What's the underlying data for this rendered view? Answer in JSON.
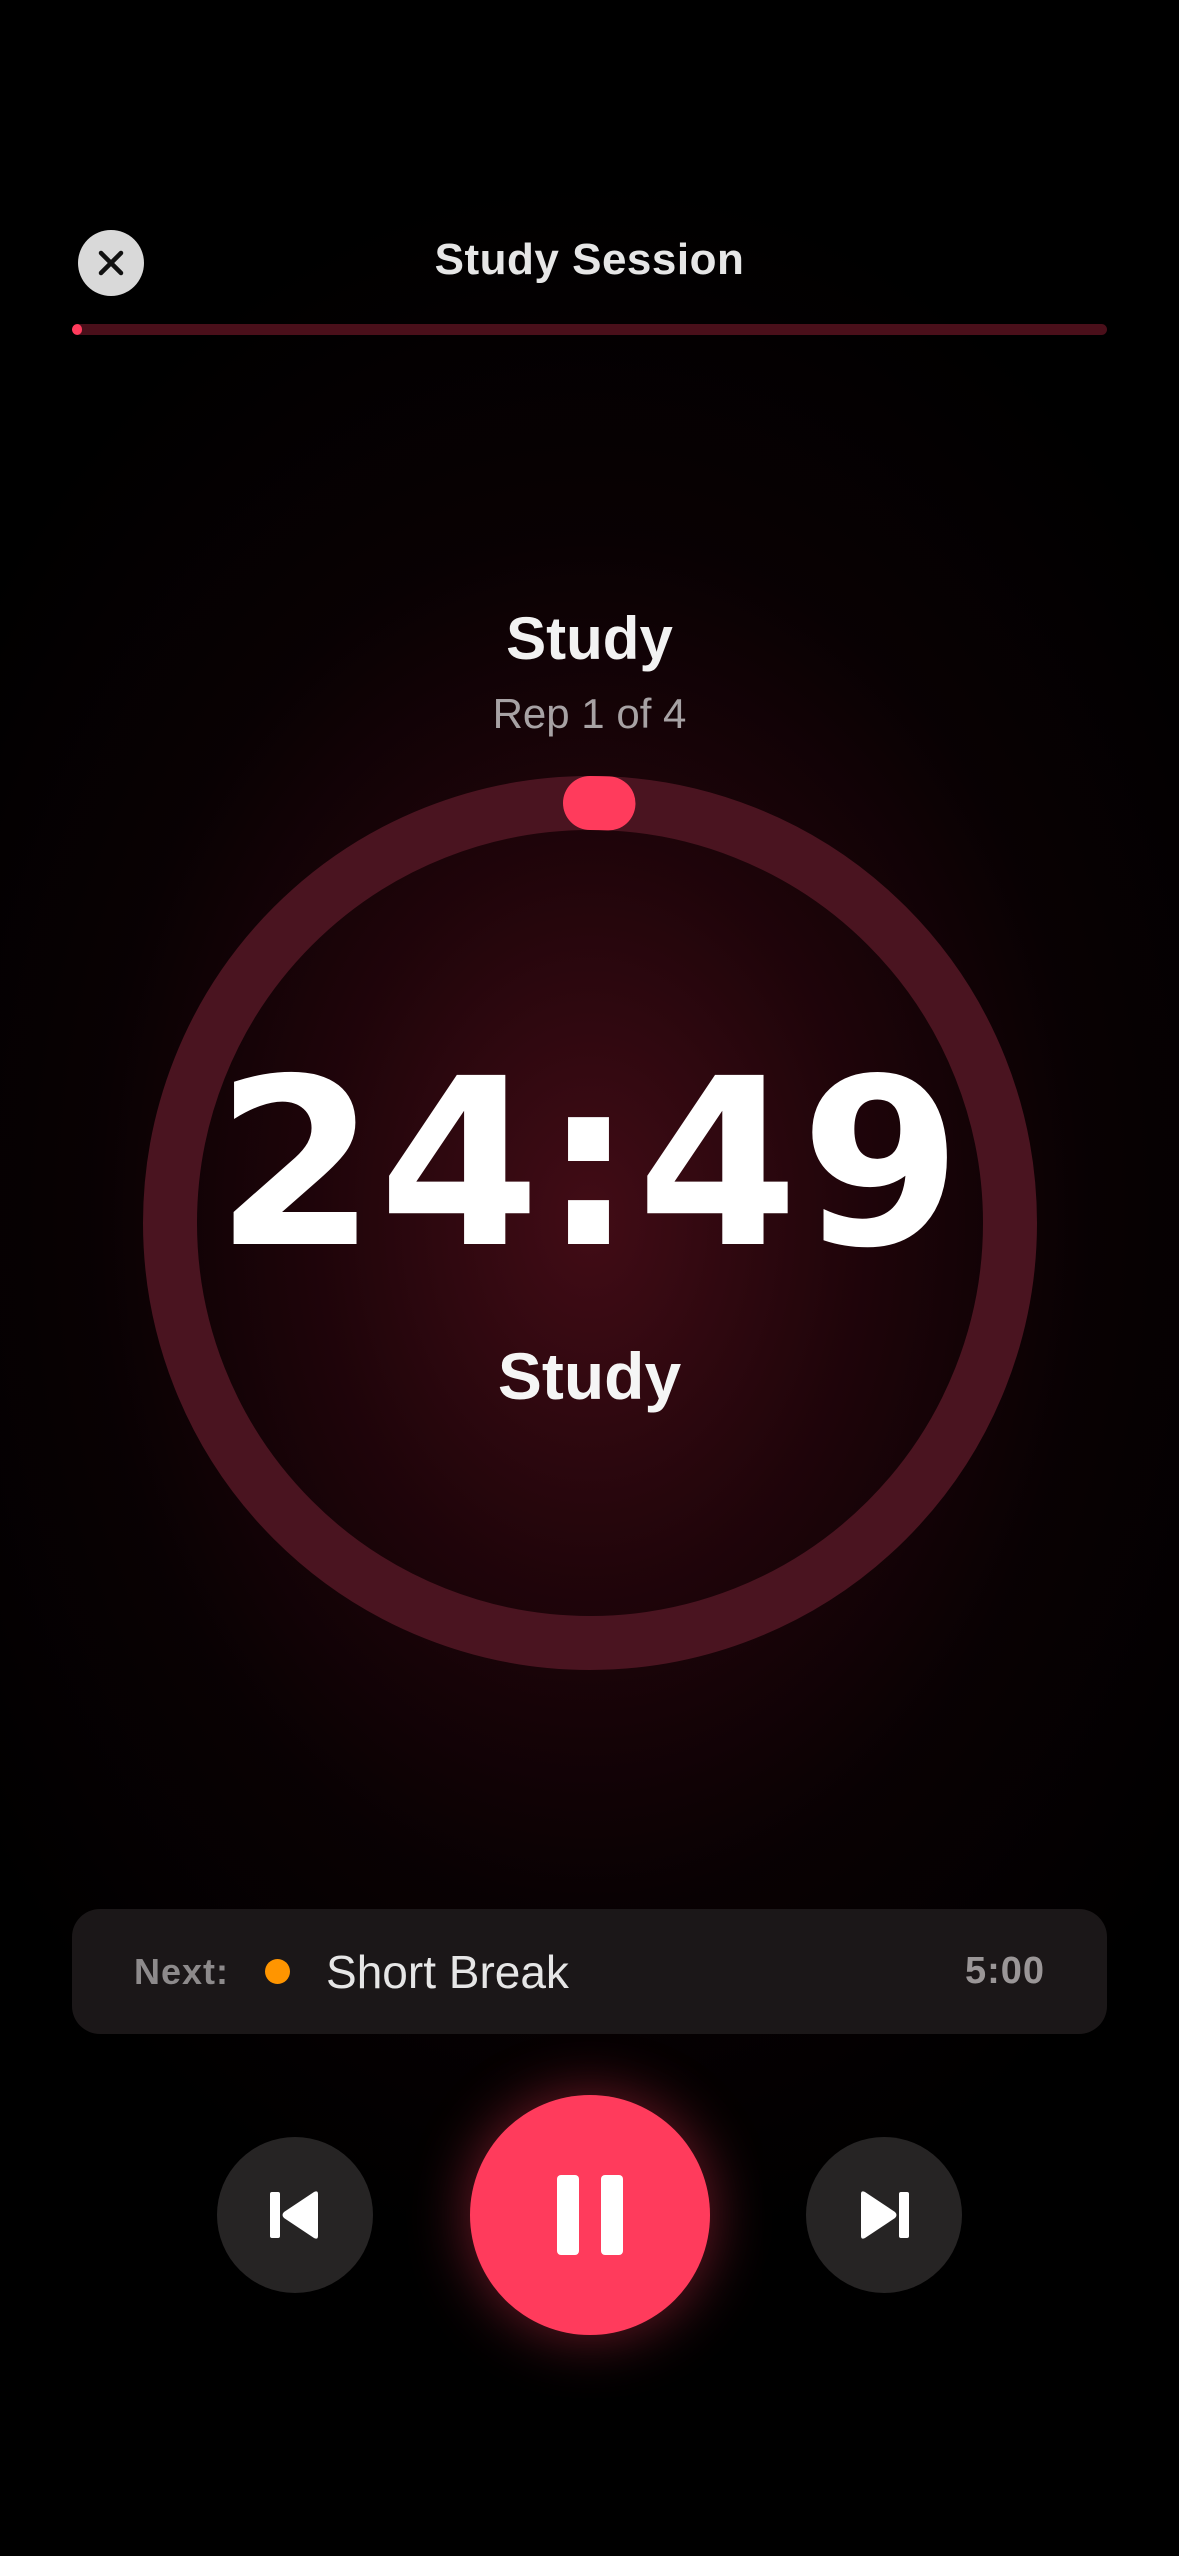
{
  "header": {
    "title": "Study Session",
    "close_icon": "close-icon",
    "session_progress": 0.01
  },
  "phase": {
    "title": "Study",
    "rep_label": "Rep 1 of 4"
  },
  "timer": {
    "time": "24:49",
    "label": "Study",
    "progress": 0.007
  },
  "next": {
    "label": "Next:",
    "name": "Short Break",
    "duration": "5:00",
    "dot_color": "#ff9500"
  },
  "controls": {
    "previous_icon": "skip-back-icon",
    "pause_icon": "pause-icon",
    "next_icon": "skip-forward-icon"
  },
  "colors": {
    "accent": "#ff3b5c",
    "ring_track": "#4a1420",
    "background": "#000000"
  }
}
